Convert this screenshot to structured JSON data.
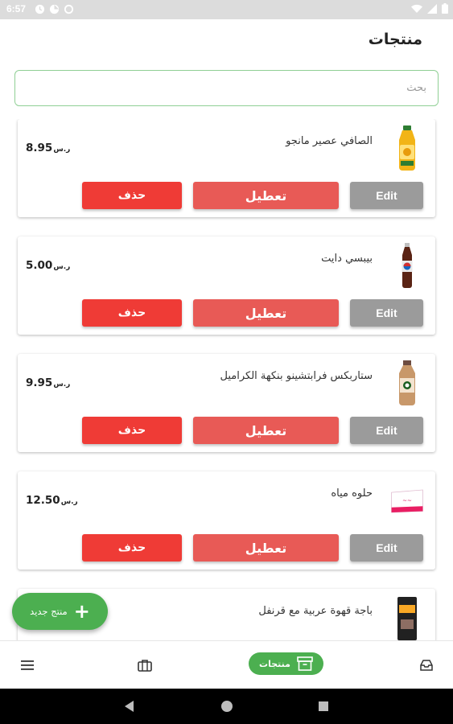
{
  "status_bar": {
    "time": "6:57",
    "left_icons": [
      "clock-icon",
      "photos-icon",
      "circle-icon"
    ],
    "right_icons": [
      "wifi-icon",
      "signal-icon",
      "battery-icon"
    ]
  },
  "header": {
    "title": "منتجات"
  },
  "search": {
    "placeholder": "بحث",
    "value": ""
  },
  "products": [
    {
      "name": "الصافي عصير مانجو",
      "price": "8.95",
      "currency": "ر.س",
      "image": "juice-bottle"
    },
    {
      "name": "بيبسي دايت",
      "price": "5.00",
      "currency": "ر.س",
      "image": "soda-bottle"
    },
    {
      "name": "ستاربكس فرابتشينو بنكهة الكراميل",
      "price": "9.95",
      "currency": "ر.س",
      "image": "coffee-bottle"
    },
    {
      "name": "حلوه مياه",
      "price": "12.50",
      "currency": "ر.س",
      "image": "water-pack"
    },
    {
      "name": "باجة قهوة عربية مع قرنفل",
      "price": "",
      "currency": "",
      "image": "coffee-pack"
    }
  ],
  "buttons": {
    "edit": "Edit",
    "disable": "تعطيل",
    "delete": "حذف"
  },
  "fab": {
    "label": "منتج جديد",
    "icon": "plus-icon"
  },
  "bottom_nav": {
    "items": [
      {
        "icon": "menu-icon"
      },
      {
        "icon": "briefcase-icon"
      },
      {
        "icon": "archive-icon",
        "label": "منتجات",
        "active": true
      },
      {
        "icon": "inbox-icon"
      }
    ]
  },
  "colors": {
    "accent": "#4caf50",
    "delete": "#ef3b36",
    "disable": "#e85a56",
    "edit": "#9b9b9b",
    "search_border": "#8fcf94"
  }
}
